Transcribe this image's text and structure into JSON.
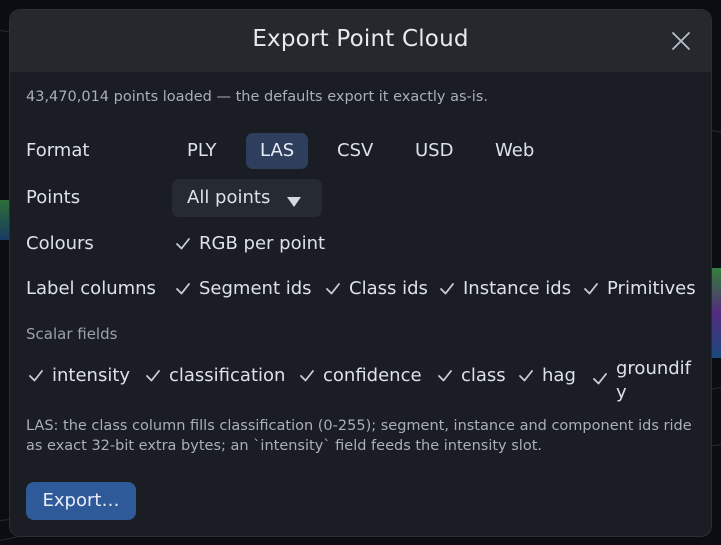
{
  "dialog": {
    "title": "Export Point Cloud",
    "summary": "43,470,014 points loaded — the defaults export it exactly as-is."
  },
  "format": {
    "label": "Format",
    "options": [
      "PLY",
      "LAS",
      "CSV",
      "USD",
      "Web"
    ],
    "selected": "LAS"
  },
  "points": {
    "label": "Points",
    "value": "All points"
  },
  "colours": {
    "label": "Colours",
    "option": "RGB per point",
    "checked": true
  },
  "label_columns": {
    "label": "Label columns",
    "options": [
      "Segment ids",
      "Class ids",
      "Instance ids",
      "Primitives"
    ]
  },
  "scalar_fields": {
    "label": "Scalar fields",
    "options": [
      "intensity",
      "classification",
      "confidence",
      "class",
      "hag",
      "groundify"
    ]
  },
  "note": "LAS: the class column fills classification (0-255); segment, instance and component ids ride as exact 32-bit extra bytes; an `intensity` field feeds the intensity slot.",
  "actions": {
    "export_label": "Export…"
  },
  "colors": {
    "accent": "#2f5a9a",
    "selected_format_bg": "#2d3f5c"
  }
}
